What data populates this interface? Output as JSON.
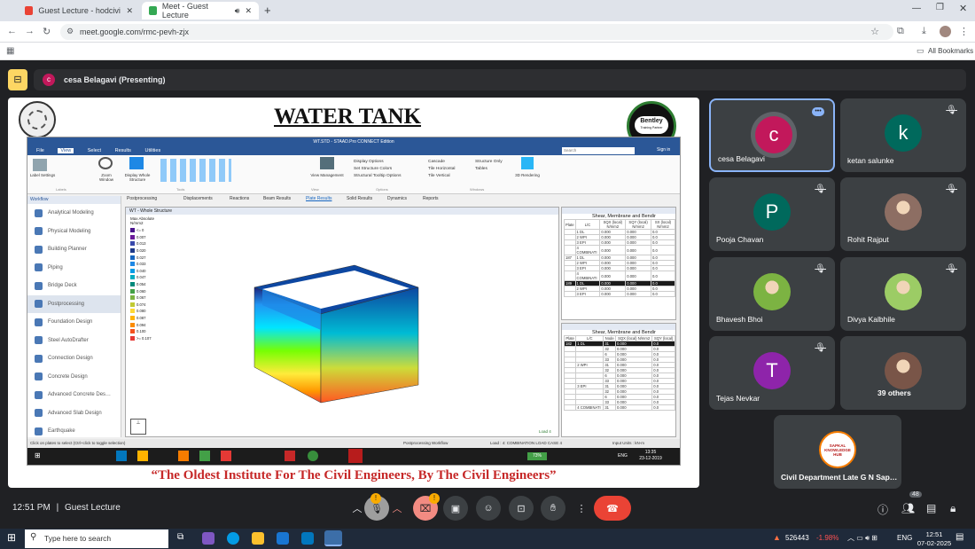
{
  "browser": {
    "tabs": [
      {
        "title": "Guest Lecture - hodcivil@gnsac…",
        "active": false
      },
      {
        "title": "Meet - Guest Lecture",
        "active": true
      }
    ],
    "url": "meet.google.com/rmc-pevh-zjx",
    "all_bookmarks": "All Bookmarks"
  },
  "meet": {
    "presenter": "cesa Belagavi (Presenting)",
    "presenter_initial": "c",
    "time": "12:51 PM",
    "meeting_title": "Guest Lecture",
    "participant_count_badge": "48",
    "participants": [
      {
        "name": "cesa Belagavi",
        "initial": "c",
        "color": "#c2185b",
        "muted": false,
        "active": true
      },
      {
        "name": "ketan salunke",
        "initial": "k",
        "color": "#00695c",
        "muted": true
      },
      {
        "name": "Pooja Chavan",
        "initial": "P",
        "color": "#00695c",
        "muted": true
      },
      {
        "name": "Rohit Rajput",
        "initial": "",
        "color": "#8d6e63",
        "muted": true,
        "photo": true
      },
      {
        "name": "Bhavesh Bhoi",
        "initial": "",
        "color": "#7cb342",
        "muted": true,
        "photo": true
      },
      {
        "name": "Divya Kalbhile",
        "initial": "",
        "color": "#9ccc65",
        "muted": true,
        "photo": true
      },
      {
        "name": "Tejas Nevkar",
        "initial": "T",
        "color": "#8e24aa",
        "muted": true
      },
      {
        "name": "39 others",
        "initial": "",
        "color": "#795548",
        "muted": false,
        "photo": true
      }
    ],
    "last_tile": {
      "name": "Civil Department Late G N Sap…",
      "logo_text": "SAPKAL KNOWLEDGE HUB"
    }
  },
  "slide": {
    "title": "WATER TANK",
    "footer": "“The Oldest Institute For The Civil Engineers, By The Civil Engineers”",
    "bentley_logo": "Bentley",
    "bentley_sub": "Training Partner"
  },
  "staad": {
    "window_title": "WT.STD - STAAD.Pro CONNECT Edition",
    "menu": [
      "File",
      "View",
      "Select",
      "Results",
      "Utilities"
    ],
    "search_placeholder": "Search",
    "sign_in": "Sign in",
    "ribbon": [
      "Label Settings",
      "Zoom Window",
      "Display Whole Structure",
      "View Management",
      "Display Options",
      "Set Structure Colors",
      "Structural Tooltip Options",
      "Cascade",
      "Tile Horizontal",
      "Tile Vertical",
      "Structure Only",
      "Tables",
      "3D Rendering"
    ],
    "ribbon_groups": [
      "Labels",
      "Tools",
      "View",
      "Options",
      "Windows"
    ],
    "mode_tabs": [
      "Postprocessing",
      "Displacements",
      "Reactions",
      "Beam Results",
      "Plate Results",
      "Solid Results",
      "Dynamics",
      "Reports"
    ],
    "workflow_title": "Workflow",
    "workflow": [
      "Analytical Modeling",
      "Physical Modeling",
      "Building Planner",
      "Piping",
      "Bridge Deck",
      "Postprocessing",
      "Foundation Design",
      "Steel AutoDrafter",
      "Connection Design",
      "Concrete Design",
      "Advanced Concrete Des…",
      "Advanced Slab Design",
      "Earthquake"
    ],
    "view_title": "WT - Whole Structure",
    "legend_title": "Max Absolute\nN/mm2",
    "legend": [
      "<= 0",
      "0.007",
      "0.013",
      "0.020",
      "0.027",
      "0.033",
      "0.040",
      "0.047",
      "0.054",
      "0.060",
      "0.067",
      "0.074",
      "0.080",
      "0.087",
      "0.094",
      "0.100",
      ">= 0.107"
    ],
    "table_title": "Shear, Membrane and Bendir",
    "table_headers": [
      "Plate",
      "L/C",
      "SQX (local) N/mm2",
      "SQY (local) N/mm2",
      "SX (local) N/mm2"
    ],
    "table_rows": [
      [
        "",
        "1 DL",
        "0.000",
        "0.000",
        "0.0"
      ],
      [
        "",
        "2 WPI",
        "0.000",
        "0.000",
        "0.0"
      ],
      [
        "",
        "3 EPI",
        "0.000",
        "0.000",
        "0.0"
      ],
      [
        "",
        "4 COMBINATI",
        "0.000",
        "0.000",
        "0.0"
      ],
      [
        "187",
        "1 DL",
        "0.000",
        "0.000",
        "0.0"
      ],
      [
        "",
        "2 WPI",
        "0.000",
        "0.000",
        "0.0"
      ],
      [
        "",
        "3 EPI",
        "0.000",
        "0.000",
        "0.0"
      ],
      [
        "",
        "4 COMBINATI",
        "0.000",
        "0.000",
        "0.0"
      ],
      [
        "189",
        "1 DL",
        "0.000",
        "0.000",
        "0.0"
      ],
      [
        "",
        "2 WPI",
        "0.000",
        "0.000",
        "0.0"
      ],
      [
        "",
        "3 EPI",
        "0.000",
        "0.000",
        "0.0"
      ]
    ],
    "table2_headers": [
      "Plate",
      "L/C",
      "Node",
      "SQX (local) N/mm2",
      "SQY (local)"
    ],
    "table2_rows": [
      [
        "182",
        "1 DL",
        "31",
        "0.000",
        "0.0"
      ],
      [
        "",
        "",
        "32",
        "0.000",
        "0.0"
      ],
      [
        "",
        "",
        "6",
        "0.000",
        "0.0"
      ],
      [
        "",
        "",
        "33",
        "0.000",
        "0.0"
      ],
      [
        "",
        "2 WPI",
        "31",
        "0.000",
        "0.0"
      ],
      [
        "",
        "",
        "32",
        "0.000",
        "0.0"
      ],
      [
        "",
        "",
        "6",
        "0.000",
        "0.0"
      ],
      [
        "",
        "",
        "33",
        "0.000",
        "0.0"
      ],
      [
        "",
        "3 EPI",
        "31",
        "0.000",
        "0.0"
      ],
      [
        "",
        "",
        "32",
        "0.000",
        "0.0"
      ],
      [
        "",
        "",
        "6",
        "0.000",
        "0.0"
      ],
      [
        "",
        "",
        "33",
        "0.000",
        "0.0"
      ],
      [
        "",
        "4 COMBINATI",
        "31",
        "0.000",
        "0.0"
      ]
    ],
    "status_left": "Click on plates to select (Ctrl+click to toggle selection)",
    "status_mid": "Postprocessing Workflow",
    "status_load": "Load : 4: COMBINATION LOAD CASE 4",
    "status_units": "Input Units : kN-m",
    "load_label": "Load 4",
    "inner_clock": "13:35",
    "inner_date": "23-12-2019",
    "inner_lang": "ENG",
    "inner_battery": "73%"
  },
  "taskbar": {
    "search_placeholder": "Type here to search",
    "stock_value": "526443",
    "stock_change": "-1.98%",
    "lang": "ENG",
    "time": "12:51",
    "date": "07-02-2025"
  }
}
